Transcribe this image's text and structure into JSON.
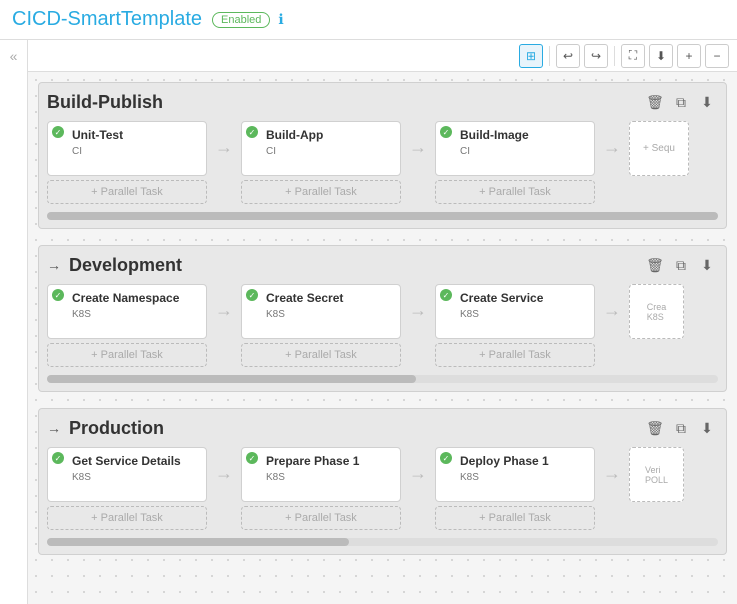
{
  "header": {
    "title": "CICD-SmartTemplate",
    "badge": "Enabled",
    "info_icon": "ℹ"
  },
  "toolbar": {
    "grid_icon": "⊞",
    "undo_icon": "↩",
    "redo_icon": "↪",
    "fit_icon": "⛶",
    "download_icon": "⬇",
    "zoom_in_icon": "🔍",
    "zoom_out_icon": "🔎"
  },
  "sidebar": {
    "collapse_icon": "«"
  },
  "phases": [
    {
      "id": "build-publish",
      "title": "Build-Publish",
      "show_arrow": false,
      "tasks": [
        {
          "name": "Unit-Test",
          "type": "CI"
        },
        {
          "name": "Build-App",
          "type": "CI"
        },
        {
          "name": "Build-Image",
          "type": "CI"
        }
      ],
      "extra_card": "Sequ",
      "add_parallel_label": "+ Parallel Task",
      "delete_icon": "🗑",
      "copy_icon": "⧉",
      "export_icon": "⬇"
    },
    {
      "id": "development",
      "title": "Development",
      "show_arrow": true,
      "tasks": [
        {
          "name": "Create Namespace",
          "type": "K8S"
        },
        {
          "name": "Create Secret",
          "type": "K8S"
        },
        {
          "name": "Create Service",
          "type": "K8S"
        }
      ],
      "extra_card": "Crea K8S",
      "add_parallel_label": "+ Parallel Task",
      "delete_icon": "🗑",
      "copy_icon": "⧉",
      "export_icon": "⬇"
    },
    {
      "id": "production",
      "title": "Production",
      "show_arrow": true,
      "tasks": [
        {
          "name": "Get Service Details",
          "type": "K8S"
        },
        {
          "name": "Prepare Phase 1",
          "type": "K8S"
        },
        {
          "name": "Deploy Phase 1",
          "type": "K8S"
        }
      ],
      "extra_card": "Veri POLL",
      "add_parallel_label": "+ Parallel Task",
      "delete_icon": "🗑",
      "copy_icon": "⧉",
      "export_icon": "⬇"
    }
  ]
}
